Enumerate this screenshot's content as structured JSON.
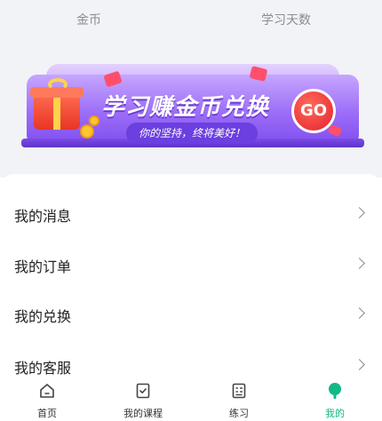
{
  "stats": {
    "coins_label": "金币",
    "days_label": "学习天数"
  },
  "banner": {
    "title": "学习赚金币兑换",
    "subtitle": "你的坚持，终将美好！",
    "go_label": "GO"
  },
  "menu": {
    "items": [
      {
        "label": "我的消息"
      },
      {
        "label": "我的订单"
      },
      {
        "label": "我的兑换"
      },
      {
        "label": "我的客服"
      }
    ]
  },
  "tabbar": {
    "tabs": [
      {
        "label": "首页",
        "icon": "home-icon",
        "active": false
      },
      {
        "label": "我的课程",
        "icon": "course-icon",
        "active": false
      },
      {
        "label": "练习",
        "icon": "practice-icon",
        "active": false
      },
      {
        "label": "我的",
        "icon": "profile-icon",
        "active": true
      }
    ],
    "active_color": "#12b886"
  }
}
